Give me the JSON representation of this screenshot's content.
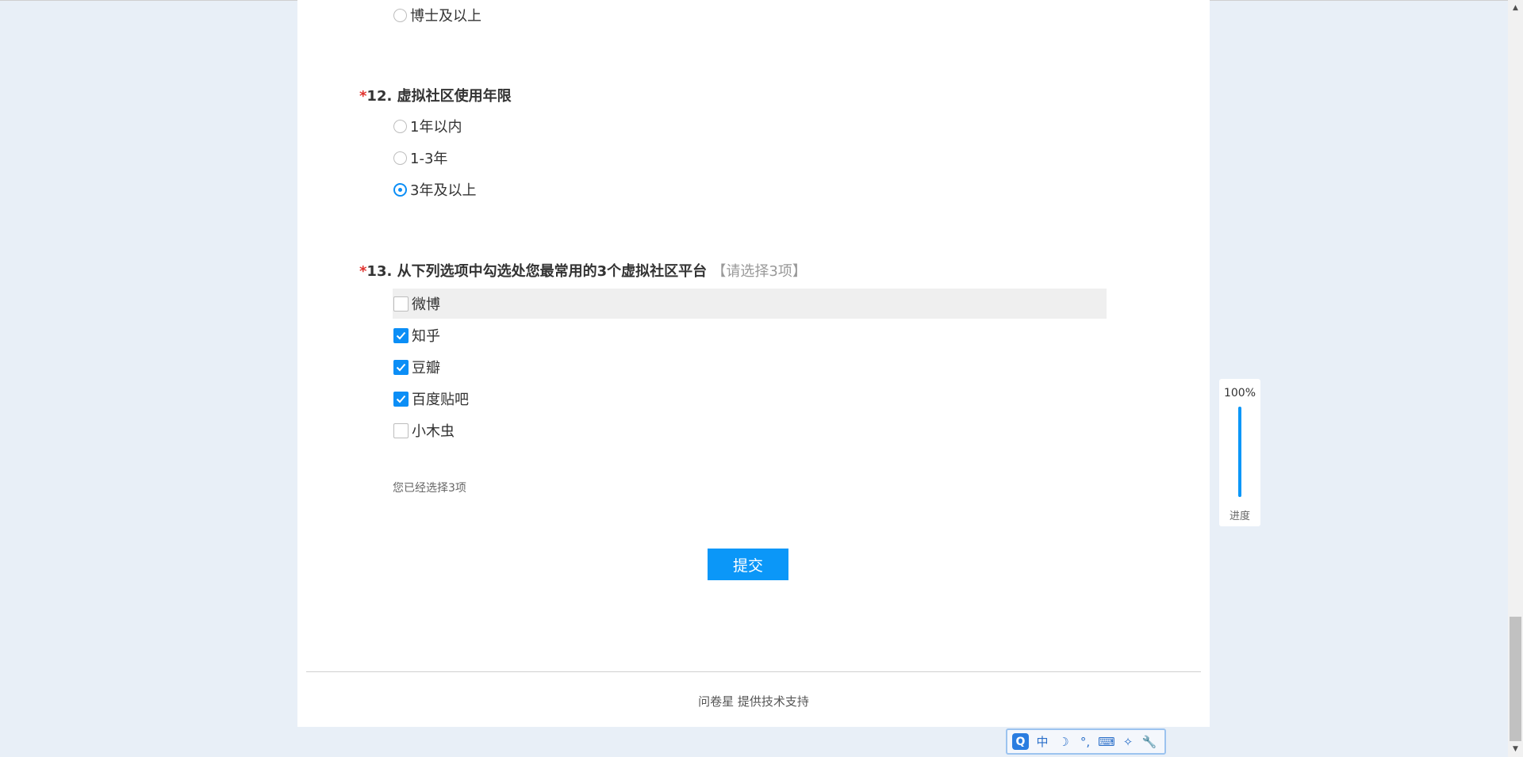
{
  "q11": {
    "last_option": "博士及以上"
  },
  "q12": {
    "required_mark": "*",
    "number": "12.",
    "title": "虚拟社区使用年限",
    "options": [
      {
        "label": "1年以内",
        "selected": false
      },
      {
        "label": "1-3年",
        "selected": false
      },
      {
        "label": "3年及以上",
        "selected": true
      }
    ]
  },
  "q13": {
    "required_mark": "*",
    "number": "13.",
    "title": "从下列选项中勾选处您最常用的3个虚拟社区平台",
    "hint": "【请选择3项】",
    "options": [
      {
        "label": "微博",
        "checked": false
      },
      {
        "label": "知乎",
        "checked": true
      },
      {
        "label": "豆瓣",
        "checked": true
      },
      {
        "label": "百度贴吧",
        "checked": true
      },
      {
        "label": "小木虫",
        "checked": false
      }
    ],
    "selected_count_text": "您已经选择3项"
  },
  "submit": {
    "label": "提交"
  },
  "footer": {
    "text": "问卷星 提供技术支持"
  },
  "progress": {
    "percent_text": "100%",
    "value": 1.0,
    "label": "进度"
  },
  "ime": {
    "items": [
      "Q",
      "中",
      "☽",
      "°,",
      "⌨",
      "✧",
      "🔧"
    ]
  },
  "colors": {
    "accent": "#0b97f8",
    "required": "#e0312d",
    "background": "#e8eff7"
  }
}
